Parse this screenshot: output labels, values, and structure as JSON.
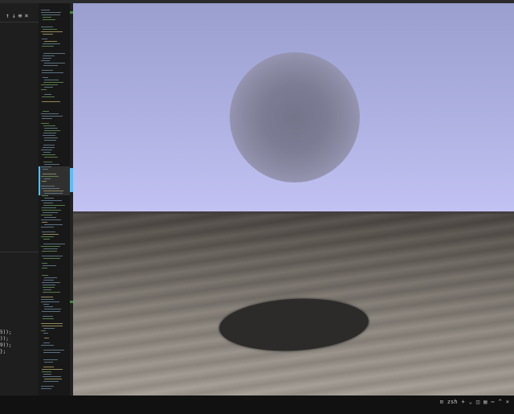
{
  "find_bar": {
    "up_icon": "↑",
    "down_icon": "↓",
    "selection_icon": "≡",
    "close_icon": "×"
  },
  "code_lines": [
    "5));",
    "));",
    "9));",
    "};"
  ],
  "status_bar": {
    "layout_icon": "⊡",
    "zoom_label": "zsh",
    "add_icon": "+",
    "dropdown_icon": "⌄",
    "split_icon": "◫",
    "trash_icon": "▤",
    "more_icon": "⋯",
    "maximize_icon": "^",
    "close_icon": "×"
  },
  "colors": {
    "sky_top": "#9a9fd0",
    "sky_bottom": "#c2c3f4",
    "sun": "#74748b",
    "ground": "#8a847c",
    "pit": "#2c2b2a"
  }
}
